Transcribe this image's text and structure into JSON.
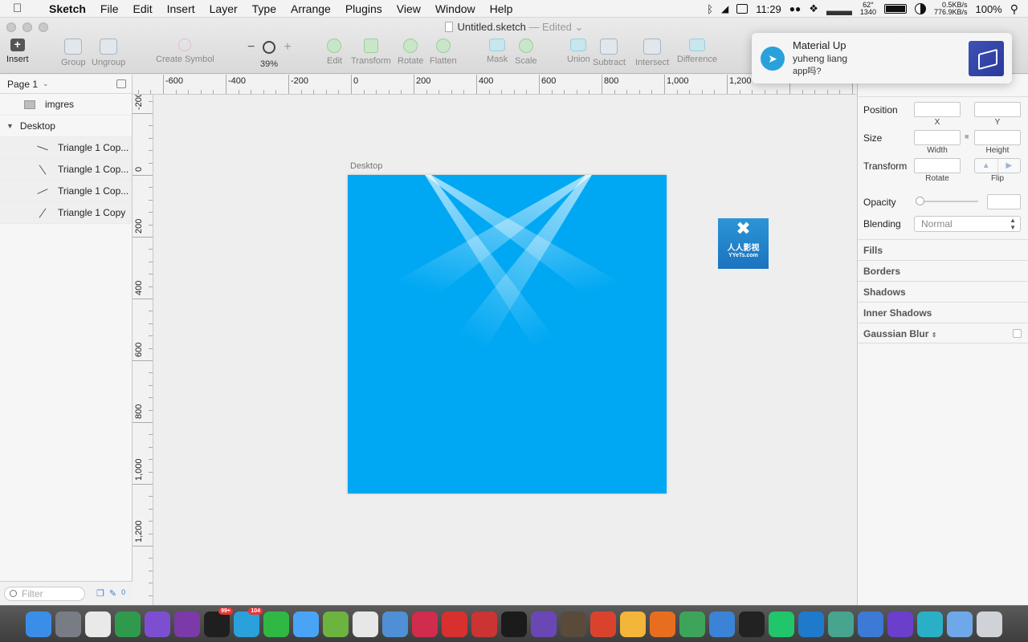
{
  "menubar": {
    "app": "Sketch",
    "items": [
      "File",
      "Edit",
      "Insert",
      "Layer",
      "Type",
      "Arrange",
      "Plugins",
      "View",
      "Window",
      "Help"
    ],
    "clock": "11:29",
    "temp": "62°",
    "temp_sub": "1340",
    "net_up": "0.5KB/s",
    "net_down": "776.9KB/s",
    "battery": "100%"
  },
  "window": {
    "title": "Untitled.sketch",
    "status": "— Edited"
  },
  "toolbar": {
    "insert": "Insert",
    "group": "Group",
    "ungroup": "Ungroup",
    "create_symbol": "Create Symbol",
    "zoom": "39%",
    "zoom_minus": "−",
    "zoom_plus": "+",
    "edit": "Edit",
    "transform": "Transform",
    "rotate": "Rotate",
    "flatten": "Flatten",
    "mask": "Mask",
    "scale": "Scale",
    "union": "Union",
    "subtract": "Subtract",
    "intersect": "Intersect",
    "difference": "Difference"
  },
  "notification": {
    "title": "Material Up",
    "sender": "yuheng liang",
    "body": "app吗?"
  },
  "layers": {
    "page": "Page 1",
    "items": [
      {
        "label": "imgres"
      },
      {
        "label": "Desktop"
      },
      {
        "label": "Triangle 1 Cop..."
      },
      {
        "label": "Triangle 1 Cop..."
      },
      {
        "label": "Triangle 1 Cop..."
      },
      {
        "label": "Triangle 1 Copy"
      }
    ],
    "filter_placeholder": "Filter",
    "count": "0"
  },
  "ruler_h": [
    "-600",
    "-400",
    "-200",
    "0",
    "200",
    "400",
    "600",
    "800",
    "1,000",
    "1,200"
  ],
  "ruler_v": [
    "-200",
    "0",
    "200",
    "400",
    "600",
    "800",
    "1,000",
    "1,200"
  ],
  "canvas": {
    "artboard_name": "Desktop",
    "artboard_color": "#00a8f3",
    "image_text": "人人影视",
    "image_sub": "YYeTs.com"
  },
  "inspector": {
    "position": "Position",
    "x": "X",
    "y": "Y",
    "size": "Size",
    "width": "Width",
    "height": "Height",
    "transform": "Transform",
    "rotate": "Rotate",
    "flip": "Flip",
    "opacity": "Opacity",
    "blending": "Blending",
    "blending_value": "Normal",
    "fills": "Fills",
    "borders": "Borders",
    "shadows": "Shadows",
    "inner_shadows": "Inner Shadows",
    "gaussian_blur": "Gaussian Blur"
  },
  "dock": {
    "apps": [
      {
        "name": "Finder",
        "color": "#3b8ee8"
      },
      {
        "name": "Launchpad",
        "color": "#777c85"
      },
      {
        "name": "App Grid",
        "color": "#e9e9e9"
      },
      {
        "name": "Chrome",
        "color": "#2f9a4b"
      },
      {
        "name": "OmniFocus",
        "color": "#7d4fd0"
      },
      {
        "name": "OneNote",
        "color": "#7b3aa8"
      },
      {
        "name": "QQ",
        "color": "#1f1f1f",
        "badge": "99+"
      },
      {
        "name": "Telegram",
        "color": "#2aa1da",
        "badge": "104"
      },
      {
        "name": "WeChat",
        "color": "#2fb844"
      },
      {
        "name": "Messages",
        "color": "#4aa4f5"
      },
      {
        "name": "Vectorize",
        "color": "#6db33f"
      },
      {
        "name": "Slack",
        "color": "#e7e7e7"
      },
      {
        "name": "Preview",
        "color": "#4f8fd6"
      },
      {
        "name": "Sound",
        "color": "#d12b4d"
      },
      {
        "name": "NetEase Music",
        "color": "#d8302f"
      },
      {
        "name": "Parallels",
        "color": "#c33"
      },
      {
        "name": "Terminal",
        "color": "#1b1b1b"
      },
      {
        "name": "GitHub",
        "color": "#6b47b6"
      },
      {
        "name": "Instruments",
        "color": "#5a4a3a"
      },
      {
        "name": "Airmail",
        "color": "#d9432e"
      },
      {
        "name": "Sketch",
        "color": "#f3b53a"
      },
      {
        "name": "Spark",
        "color": "#e96d1f"
      },
      {
        "name": "Android Studio",
        "color": "#3da55a"
      },
      {
        "name": "Xcode",
        "color": "#3b83d6"
      },
      {
        "name": "AppCode",
        "color": "#222"
      },
      {
        "name": "PyCharm",
        "color": "#21c56a"
      },
      {
        "name": "VS Code",
        "color": "#1f7acb"
      },
      {
        "name": "Atom",
        "color": "#47a48e"
      },
      {
        "name": "Files",
        "color": "#3c7ad5"
      },
      {
        "name": "Dash",
        "color": "#6b3fcc"
      },
      {
        "name": "WebStorm",
        "color": "#2ab0c6"
      },
      {
        "name": "Downloads",
        "color": "#6fa8e8"
      },
      {
        "name": "Trash",
        "color": "#cfd3d8"
      }
    ]
  }
}
